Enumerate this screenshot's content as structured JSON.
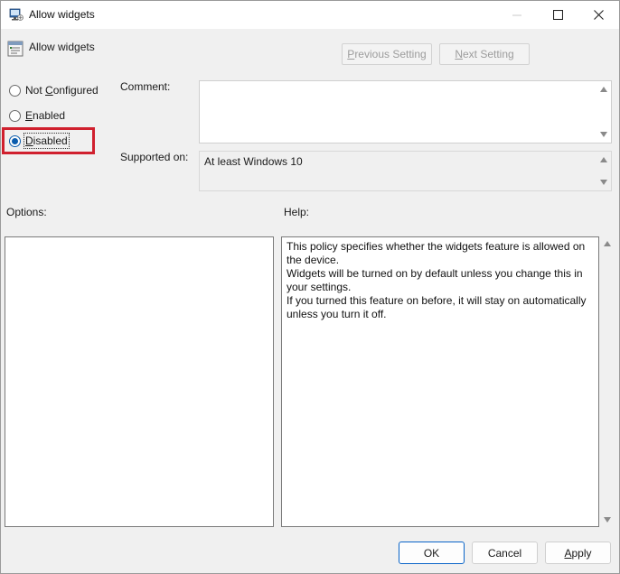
{
  "window": {
    "title": "Allow widgets"
  },
  "header": {
    "title": "Allow widgets"
  },
  "nav": {
    "previous": {
      "label": "Previous Setting",
      "accel": "P",
      "rest": "revious Setting"
    },
    "next": {
      "label": "Next Setting",
      "accel": "N",
      "rest": "ext Setting"
    }
  },
  "radios": {
    "not_configured": {
      "label": "Not Configured",
      "accel": "C",
      "pre": "Not ",
      "rest": "onfigured",
      "checked": false
    },
    "enabled": {
      "label": "Enabled",
      "accel": "E",
      "pre": "",
      "rest": "nabled",
      "checked": false
    },
    "disabled": {
      "label": "Disabled",
      "accel": "D",
      "pre": "",
      "rest": "isabled",
      "checked": true
    }
  },
  "fields": {
    "comment_label": "Comment:",
    "comment_value": "",
    "supported_label": "Supported on:",
    "supported_value": "At least Windows 10"
  },
  "options": {
    "label": "Options:"
  },
  "help": {
    "label": "Help:",
    "lines": [
      "This policy specifies whether the widgets feature is allowed on the device.",
      "Widgets will be turned on by default unless you change this in your settings.",
      "If you turned this feature on before, it will stay on automatically unless you turn it off."
    ]
  },
  "buttons": {
    "ok": "OK",
    "cancel": "Cancel",
    "apply": {
      "label": "Apply",
      "accel": "A",
      "rest": "pply"
    }
  },
  "colors": {
    "accent": "#0b5cad",
    "highlight": "#d0202e"
  }
}
